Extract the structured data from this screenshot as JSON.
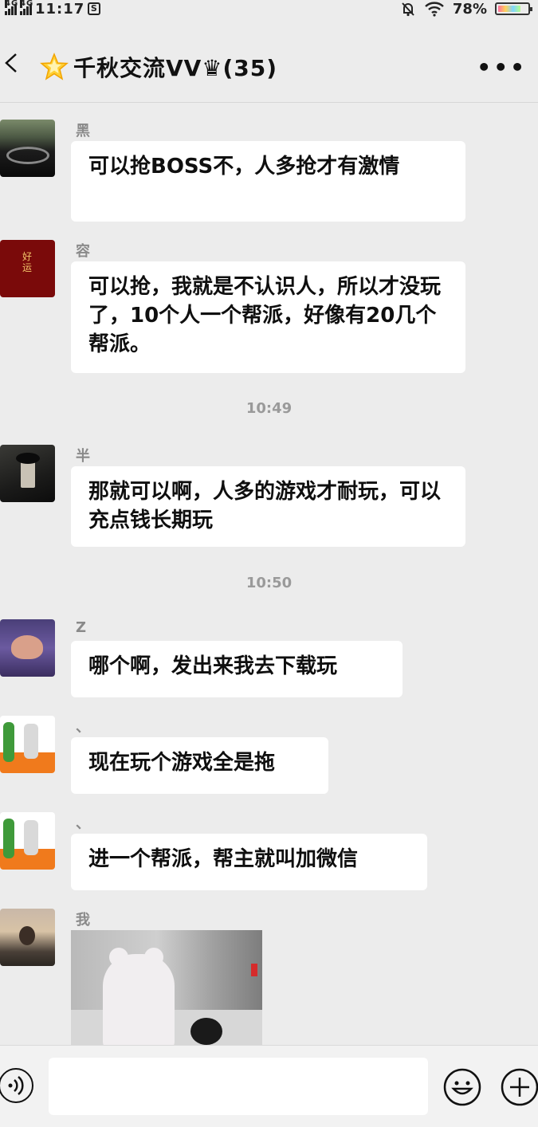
{
  "status_bar": {
    "network_1": "4G",
    "network_2": "4G",
    "time": "11:17",
    "battery": "78%",
    "battery_level": 0.78
  },
  "header": {
    "title": "千秋交流VV♛(35)"
  },
  "messages": [
    {
      "sender": "黑 桃 K",
      "text": "可以抢BOSS不，人多抢才有激情"
    },
    {
      "sender": "容易",
      "text": "可以抢，我就是不认识人，所以才没玩了，10个人一个帮派，好像有20几个帮派。",
      "avatar_text": "好运"
    },
    {
      "sender": "半枫",
      "text": "那就可以啊，人多的游戏才耐玩，可以充点钱长期玩"
    },
    {
      "sender": "Z",
      "text": "哪个啊，发出来我去下载玩"
    },
    {
      "sender": "、",
      "text": "现在玩个游戏全是拖"
    },
    {
      "sender": "、",
      "text": "进一个帮派，帮主就叫加微信"
    },
    {
      "sender": "我的昵称",
      "text": ""
    }
  ],
  "times": [
    "10:49",
    "10:50"
  ],
  "colors": {
    "background": "#ececec",
    "bubble": "#ffffff",
    "meta_text": "#9a9a9a"
  }
}
